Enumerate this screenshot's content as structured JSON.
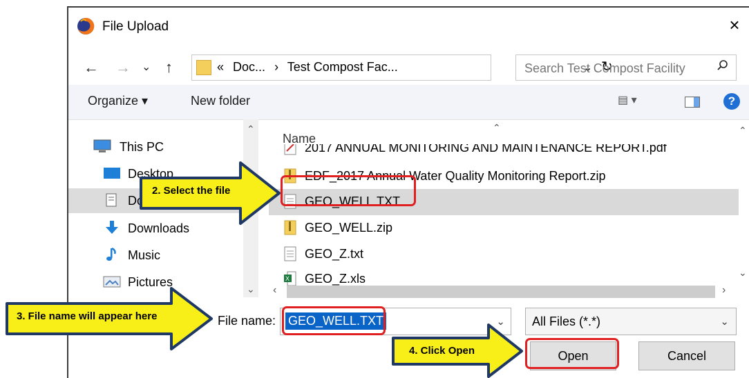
{
  "dialog": {
    "title": "File Upload",
    "close_glyph": "×"
  },
  "nav": {
    "back": "←",
    "forward": "→",
    "recent": "⌄",
    "up": "↑",
    "breadcrumbs": [
      "«",
      "Doc...",
      "›",
      "Test Compost Fac..."
    ],
    "addr_dropdown": "⌄",
    "refresh": "↻",
    "search_placeholder": "Search Test Compost Facility"
  },
  "toolbar": {
    "organize": "Organize ▾",
    "new_folder": "New folder"
  },
  "sidebar": {
    "items": [
      {
        "label": "This PC",
        "icon": "pc-icon"
      },
      {
        "label": "Desktop",
        "icon": "desktop-icon"
      },
      {
        "label": "Documents",
        "icon": "documents-icon"
      },
      {
        "label": "Downloads",
        "icon": "downloads-icon"
      },
      {
        "label": "Music",
        "icon": "music-icon"
      },
      {
        "label": "Pictures",
        "icon": "pictures-icon"
      }
    ]
  },
  "files": {
    "column_header": "Name",
    "items": [
      {
        "label": "2017 ANNUAL MONITORING AND MAINTENANCE REPORT.pdf",
        "icon": "pdf-icon"
      },
      {
        "label": "EDF_2017 Annual Water Quality Monitoring Report.zip",
        "icon": "zip-icon"
      },
      {
        "label": "GEO_WELL.TXT",
        "icon": "txt-icon"
      },
      {
        "label": "GEO_WELL.zip",
        "icon": "zip-icon"
      },
      {
        "label": "GEO_Z.txt",
        "icon": "txt-icon"
      },
      {
        "label": "GEO_Z.xls",
        "icon": "excel-icon"
      }
    ]
  },
  "footer": {
    "file_name_label": "File name:",
    "file_name_value": "GEO_WELL.TXT",
    "file_type_value": "All Files (*.*)",
    "open_label": "Open",
    "cancel_label": "Cancel"
  },
  "annotations": {
    "step2": "2. Select the file",
    "step3": "3. File name will appear here",
    "step4": "4. Click Open"
  },
  "colors": {
    "callout_fill": "#f7ef17",
    "callout_stroke": "#1f3864",
    "highlight_box": "#e02020",
    "selection_blue": "#0a64c8"
  }
}
